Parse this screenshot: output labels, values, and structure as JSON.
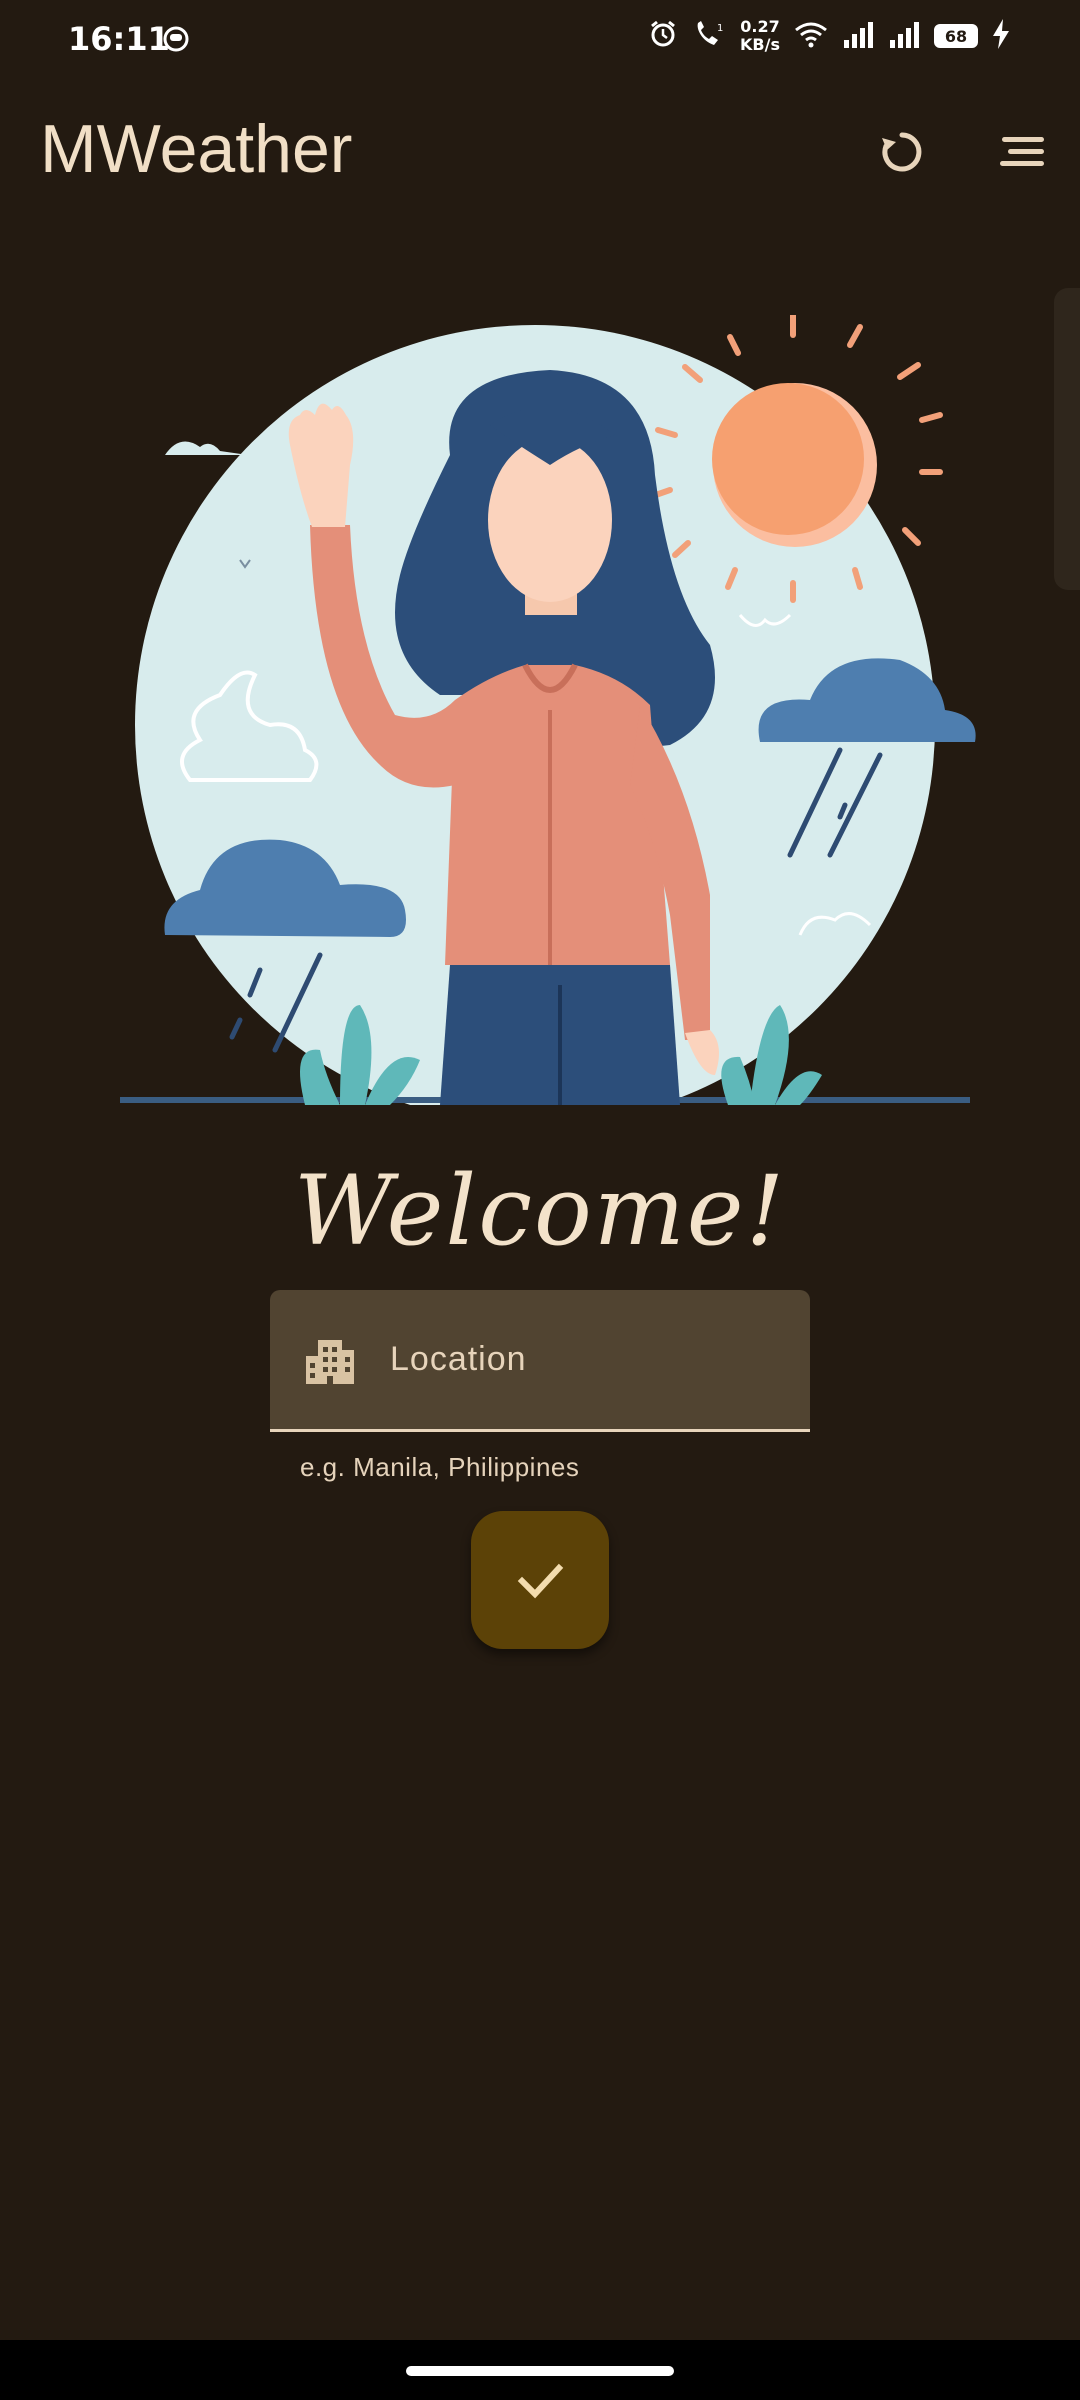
{
  "status_bar": {
    "time": "16:11",
    "net_speed_value": "0.27",
    "net_speed_unit": "KB/s",
    "battery_level": "68"
  },
  "app_bar": {
    "title": "MWeather",
    "refresh_icon": "refresh-icon",
    "menu_icon": "menu-icon"
  },
  "main": {
    "heading": "Welcome!",
    "location_placeholder": "Location",
    "location_value": "",
    "helper_text": "e.g. Manila, Philippines",
    "field_icon": "city-icon",
    "confirm_icon": "check-icon"
  },
  "colors": {
    "background": "#231a11",
    "text": "#f1dfc6",
    "field_fill": "#514431",
    "button_fill": "#5c4207"
  }
}
